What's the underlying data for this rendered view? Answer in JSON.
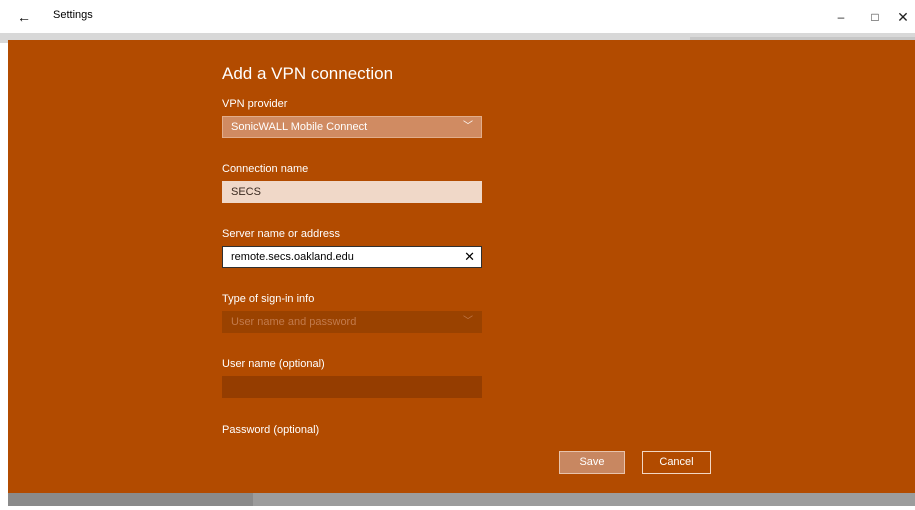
{
  "window": {
    "title": "Settings",
    "back_icon": "←",
    "minimize_icon": "–",
    "maximize_icon": "□",
    "close_icon": "✕"
  },
  "dialog": {
    "title": "Add a VPN connection",
    "vpn_provider": {
      "label": "VPN provider",
      "selected": "SonicWALL Mobile Connect",
      "chevron": "﹀"
    },
    "connection_name": {
      "label": "Connection name",
      "value": "SECS"
    },
    "server": {
      "label": "Server name or address",
      "value": "remote.secs.oakland.edu",
      "clear_icon": "✕"
    },
    "sign_in_type": {
      "label": "Type of sign-in info",
      "selected": "User name and password",
      "chevron": "﹀"
    },
    "user_name": {
      "label": "User name (optional)",
      "value": ""
    },
    "password": {
      "label": "Password (optional)"
    },
    "save_label": "Save",
    "cancel_label": "Cancel"
  },
  "colors": {
    "accent": "#b24b00",
    "save_button": "#c88761"
  }
}
